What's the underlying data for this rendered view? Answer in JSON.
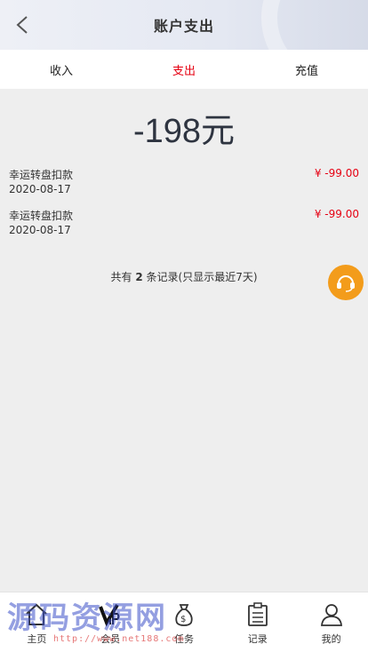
{
  "header": {
    "title": "账户支出"
  },
  "tabs": [
    {
      "label": "收入",
      "active": false
    },
    {
      "label": "支出",
      "active": true
    },
    {
      "label": "充值",
      "active": false
    }
  ],
  "total": "-198元",
  "records": [
    {
      "name": "幸运转盘扣款",
      "date": "2020-08-17",
      "amount": "¥ -99.00"
    },
    {
      "name": "幸运转盘扣款",
      "date": "2020-08-17",
      "amount": "¥ -99.00"
    }
  ],
  "summary": {
    "prefix": "共有",
    "count": "2",
    "suffix": "条记录(只显示最近7天)"
  },
  "tabbar": [
    {
      "label": "主页",
      "icon": "home-icon"
    },
    {
      "label": "会员",
      "icon": "vip-icon"
    },
    {
      "label": "任务",
      "icon": "money-bag-icon"
    },
    {
      "label": "记录",
      "icon": "clipboard-icon"
    },
    {
      "label": "我的",
      "icon": "user-icon"
    }
  ],
  "watermark": {
    "text": "源码资源网",
    "url": "http://www.net188.com"
  },
  "colors": {
    "accent": "#e60012",
    "service": "#f39c1b",
    "background": "#eeeeee"
  }
}
